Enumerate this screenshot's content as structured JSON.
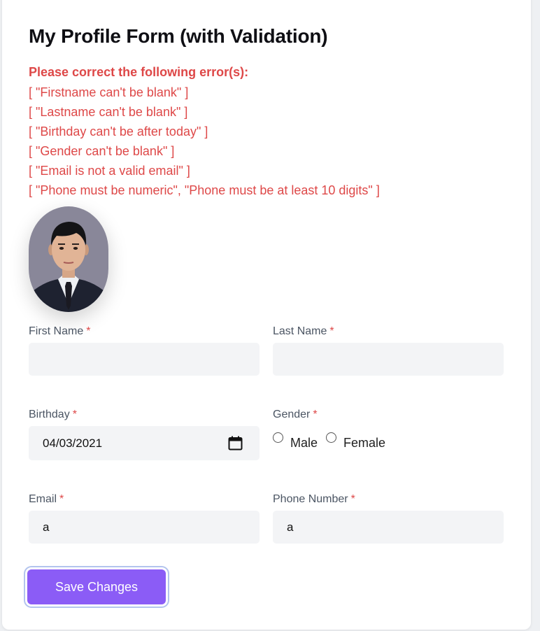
{
  "form": {
    "title": "My Profile Form (with Validation)",
    "error_heading": "Please correct the following error(s):",
    "errors": [
      "[ \"Firstname can't be blank\" ]",
      "[ \"Lastname can't be blank\" ]",
      "[ \"Birthday can't be after today\" ]",
      "[ \"Gender can't be blank\" ]",
      "[ \"Email is not a valid email\" ]",
      "[ \"Phone must be numeric\", \"Phone must be at least 10 digits\" ]"
    ],
    "required_mark": "*",
    "first_name": {
      "label": "First Name",
      "value": ""
    },
    "last_name": {
      "label": "Last Name",
      "value": ""
    },
    "birthday": {
      "label": "Birthday",
      "value": "04/03/2021"
    },
    "gender": {
      "label": "Gender",
      "options": [
        "Male",
        "Female"
      ],
      "selected": ""
    },
    "email": {
      "label": "Email",
      "value": "a"
    },
    "phone": {
      "label": "Phone Number",
      "value": "a"
    },
    "save_label": "Save Changes"
  },
  "colors": {
    "error": "#de4848",
    "accent": "#8b5cf6",
    "field_bg": "#f3f4f6"
  },
  "icons": {
    "avatar": "profile-photo",
    "date_picker": "calendar-icon"
  }
}
